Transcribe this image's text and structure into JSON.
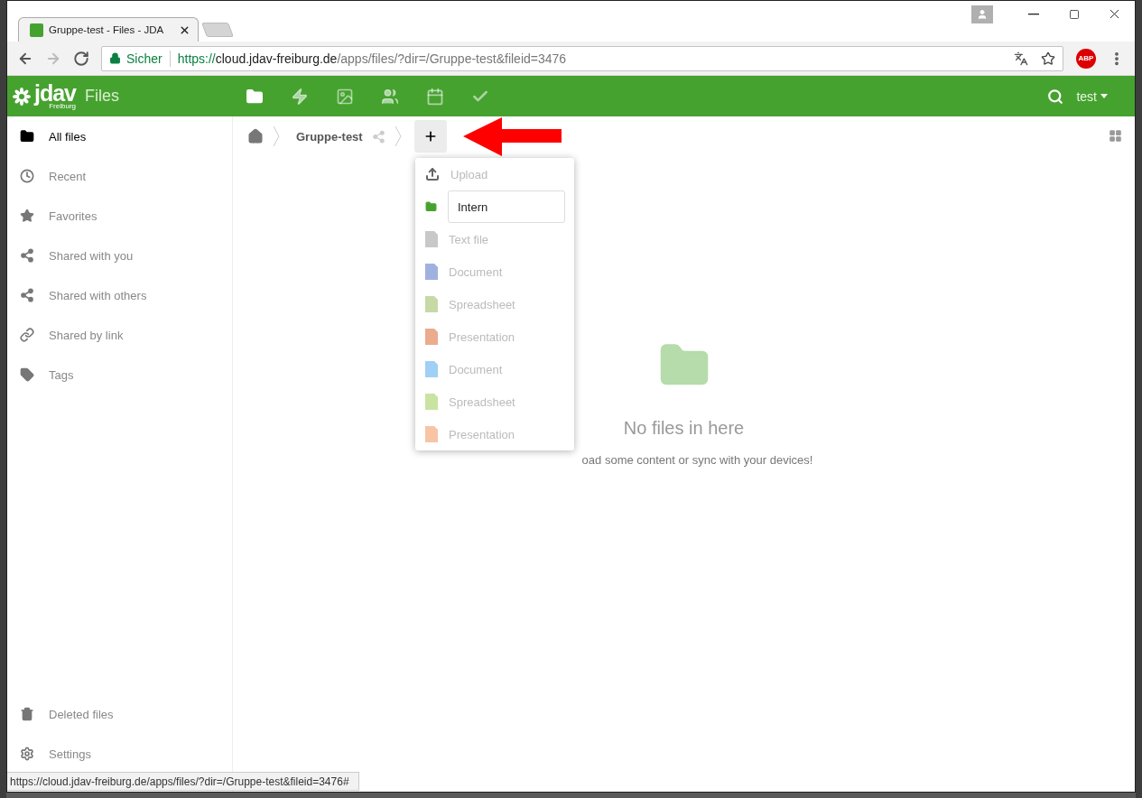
{
  "browser": {
    "tabs": [
      {
        "title": "Gruppe-test - Files - JDA",
        "selected": true
      }
    ],
    "navigation": [
      {
        "kind": "back",
        "disabled": false
      },
      {
        "kind": "forward",
        "disabled": true
      },
      {
        "kind": "reload",
        "disabled": false
      }
    ],
    "address": {
      "security": "Sicher",
      "scheme": "https://",
      "host": "cloud.jdav-freiburg.de",
      "path": "/apps/files/?dir=/Gruppe-test&fileid=3476"
    },
    "extension": "ABP"
  },
  "header": {
    "logo": "jdav",
    "logo_sub": "Freiburg",
    "app_name": "Files",
    "apps": [
      {
        "kind": "files",
        "selected": true
      },
      {
        "kind": "activity",
        "selected": false
      },
      {
        "kind": "gallery",
        "selected": false
      },
      {
        "kind": "contacts",
        "selected": false
      },
      {
        "kind": "calendar",
        "selected": false
      },
      {
        "kind": "tasks",
        "selected": false
      }
    ],
    "user": "test"
  },
  "sidebar": {
    "items": [
      {
        "kind": "folder",
        "label": "All files",
        "selected": true
      },
      {
        "kind": "clock",
        "label": "Recent",
        "selected": false
      },
      {
        "kind": "star",
        "label": "Favorites",
        "selected": false
      },
      {
        "kind": "share",
        "label": "Shared with you",
        "selected": false
      },
      {
        "kind": "share",
        "label": "Shared with others",
        "selected": false
      },
      {
        "kind": "link",
        "label": "Shared by link",
        "selected": false
      },
      {
        "kind": "tag",
        "label": "Tags",
        "selected": false
      }
    ],
    "bottom": [
      {
        "kind": "trash",
        "label": "Deleted files"
      },
      {
        "kind": "gear",
        "label": "Settings"
      }
    ]
  },
  "breadcrumb": {
    "items": [
      {
        "label": "Gruppe-test"
      }
    ]
  },
  "new_menu": {
    "items": [
      {
        "kind": "upload",
        "label": "Upload"
      },
      {
        "kind": "folder",
        "value": "Intern"
      },
      {
        "kind": "file",
        "label": "Text file",
        "color": "#c8c8c8"
      },
      {
        "kind": "file",
        "label": "Document",
        "color": "#9fb2df"
      },
      {
        "kind": "file",
        "label": "Spreadsheet",
        "color": "#c6d9a6"
      },
      {
        "kind": "file",
        "label": "Presentation",
        "color": "#ebab8d"
      },
      {
        "kind": "file",
        "label": "Document",
        "color": "#9fd0f5"
      },
      {
        "kind": "file",
        "label": "Spreadsheet",
        "color": "#c9e3a1"
      },
      {
        "kind": "file",
        "label": "Presentation",
        "color": "#f7c4a6"
      }
    ]
  },
  "empty": {
    "title": "No files in here",
    "hint": "oad some content or sync with your devices!"
  },
  "status_url": "https://cloud.jdav-freiburg.de/apps/files/?dir=/Gruppe-test&fileid=3476#"
}
